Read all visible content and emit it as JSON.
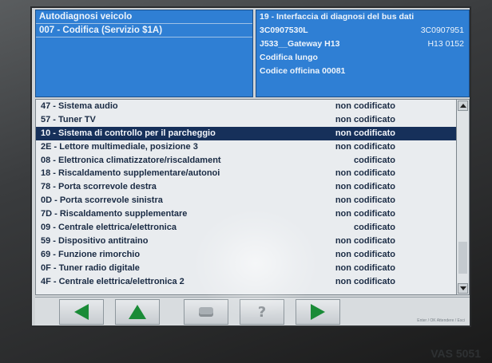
{
  "header": {
    "left_rows": [
      "Autodiagnosi veicolo",
      "007 - Codifica (Servizio $1A)"
    ],
    "right_lines": [
      {
        "text": "19 - Interfaccia di diagnosi del bus dati",
        "right": ""
      },
      {
        "text": "3C0907530L",
        "right": "3C0907951"
      },
      {
        "text": "J533__Gateway  H13",
        "right": "H13  0152"
      },
      {
        "text": "Codifica lungo",
        "right": ""
      },
      {
        "text": "Codice officina 00081",
        "right": ""
      }
    ]
  },
  "list": {
    "items": [
      {
        "name": "47 - Sistema audio",
        "status": "non codificato"
      },
      {
        "name": "57 - Tuner TV",
        "status": "non codificato"
      },
      {
        "name": "10 - Sistema di controllo per il parcheggio",
        "status": "non codificato"
      },
      {
        "name": "2E - Lettore multimediale, posizione 3",
        "status": "non codificato"
      },
      {
        "name": "08 - Elettronica climatizzatore/riscaldament",
        "status": "codificato"
      },
      {
        "name": "18 - Riscaldamento supplementare/autonoi",
        "status": "non codificato"
      },
      {
        "name": "78 - Porta scorrevole destra",
        "status": "non codificato"
      },
      {
        "name": "0D - Porta scorrevole sinistra",
        "status": "non codificato"
      },
      {
        "name": "7D - Riscaldamento supplementare",
        "status": "non codificato"
      },
      {
        "name": "09 - Centrale elettrica/elettronica",
        "status": "codificato"
      },
      {
        "name": "59 - Dispositivo antitraino",
        "status": "non codificato"
      },
      {
        "name": "69 - Funzione rimorchio",
        "status": "non codificato"
      },
      {
        "name": "0F - Tuner radio digitale",
        "status": "non codificato"
      },
      {
        "name": "4F - Centrale elettrica/elettronica 2",
        "status": "non codificato"
      }
    ],
    "selected_index": 2
  },
  "toolbar": {
    "status_text": "Enter / OK  Attendere   /  Esci"
  },
  "watermark": "VAS 5051"
}
